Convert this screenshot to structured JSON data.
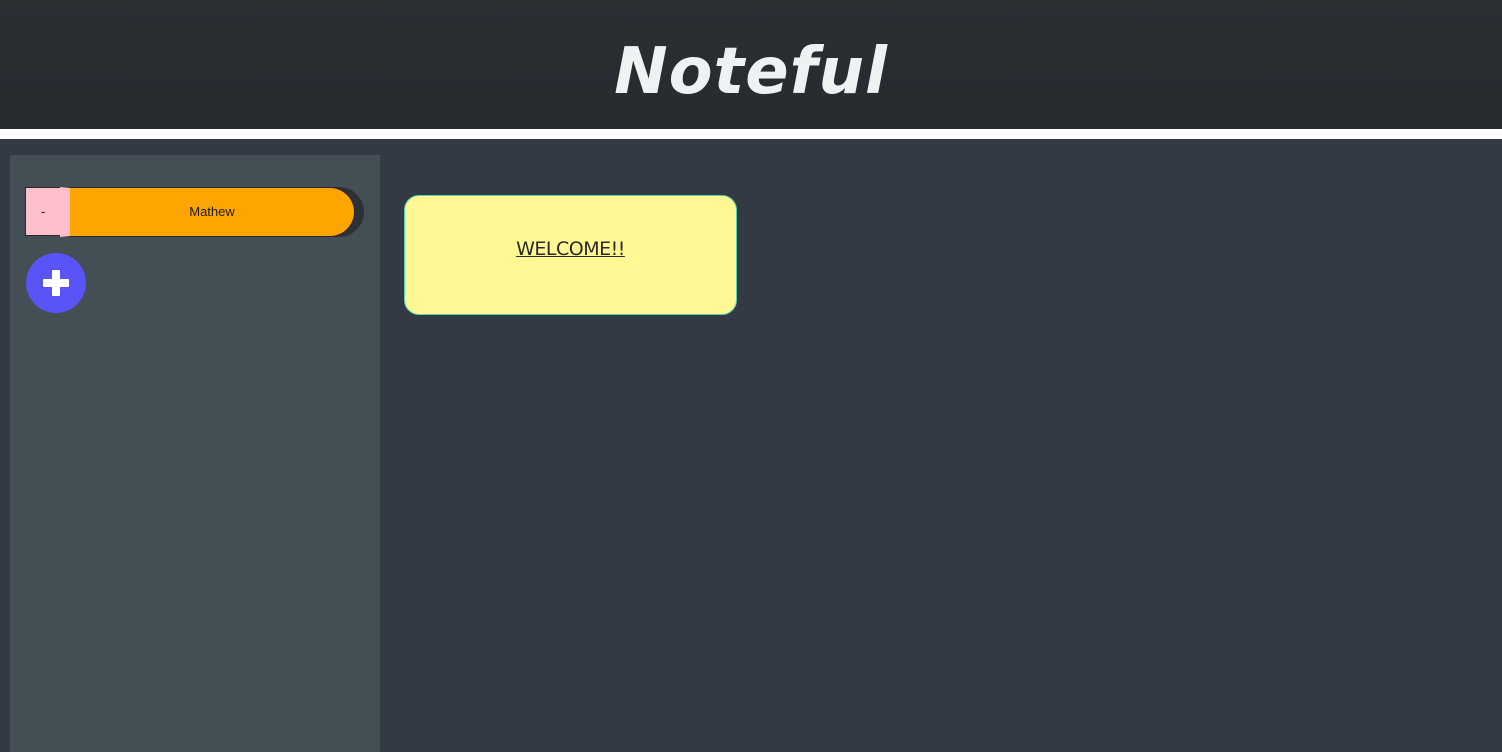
{
  "header": {
    "title": "Noteful"
  },
  "sidebar": {
    "folders": [
      {
        "delete_label": "-",
        "name": "Mathew"
      }
    ],
    "add_folder_icon": "plus-icon"
  },
  "main": {
    "welcome_card": {
      "label": "WELCOME!!"
    }
  },
  "colors": {
    "header_bg": "#2b2f34",
    "main_bg": "#333a43",
    "sidebar_bg": "#444f55",
    "folder_bg": "#ffa500",
    "delete_bg": "#ffc0cb",
    "add_button_bg": "#5a54f7",
    "card_bg": "#fff893",
    "title_color": "#edf3f3"
  }
}
